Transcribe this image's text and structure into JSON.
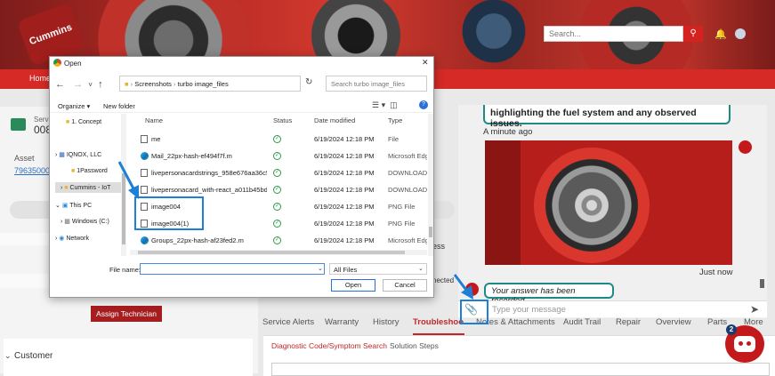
{
  "header": {
    "logo_text": "Cummins",
    "search_placeholder": "Search...",
    "nav_home": "Home"
  },
  "left_panel": {
    "service_label": "Servi",
    "service_value": "008",
    "asset_label": "Asset",
    "asset_value": "79635000",
    "assign_button": "Assign Technician",
    "customer_heading": "Customer"
  },
  "tabs": {
    "items": [
      "Service Alerts",
      "Warranty",
      "History",
      "Troubleshoo",
      "Notes & Attachments",
      "Audit Trail",
      "Repair",
      "Overview",
      "Parts",
      "More"
    ],
    "active": "Troubleshoo",
    "subtabs": [
      "Diagnostic Code/Symptom Search",
      "Solution Steps"
    ]
  },
  "chat": {
    "message1": "highlighting the fuel system and any observed issues.",
    "time1": "A minute ago",
    "time2": "Just now",
    "message2": "Your answer has been recorded.",
    "input_placeholder": "Type your message",
    "bot_badge": "2",
    "partial_less": "ess",
    "partial_connected": "nected"
  },
  "dialog": {
    "title": "Open",
    "address": [
      "Screenshots",
      "turbo image_files"
    ],
    "search_placeholder": "Search turbo image_files",
    "organize": "Organize",
    "new_folder": "New folder",
    "tree": [
      {
        "label": "1. Concept",
        "indent": 1
      },
      {
        "label": "IQNOX, LLC",
        "indent": 0
      },
      {
        "label": "1Password",
        "indent": 1
      },
      {
        "label": "Cummins - IoT",
        "indent": 1,
        "selected": true
      },
      {
        "label": "This PC",
        "indent": 0
      },
      {
        "label": "Windows (C:)",
        "indent": 1
      },
      {
        "label": "Network",
        "indent": 0
      }
    ],
    "columns": [
      "Name",
      "Status",
      "Date modified",
      "Type"
    ],
    "files": [
      {
        "name": "me",
        "date": "6/19/2024 12:18 PM",
        "type": "File",
        "icon": "file"
      },
      {
        "name": "Mail_22px-hash-ef494f7f.m",
        "date": "6/19/2024 12:18 PM",
        "type": "Microsoft Edg",
        "icon": "edge"
      },
      {
        "name": "livepersonacardstrings_958e676aa36c53...",
        "date": "6/19/2024 12:18 PM",
        "type": "DOWNLOAD F",
        "icon": "file"
      },
      {
        "name": "livepersonacard_with-react_a011b45bd9...",
        "date": "6/19/2024 12:18 PM",
        "type": "DOWNLOAD F",
        "icon": "file"
      },
      {
        "name": "image004",
        "date": "6/19/2024 12:18 PM",
        "type": "PNG File",
        "icon": "file"
      },
      {
        "name": "image004(1)",
        "date": "6/19/2024 12:18 PM",
        "type": "PNG File",
        "icon": "file"
      },
      {
        "name": "Groups_22px-hash-af23fed2.m",
        "date": "6/19/2024 12:18 PM",
        "type": "Microsoft Edg",
        "icon": "edge"
      }
    ],
    "file_name_label": "File name:",
    "file_name_value": "",
    "filter": "All Files",
    "open_button": "Open",
    "cancel_button": "Cancel"
  },
  "colors": {
    "brand_red": "#d52a26",
    "highlight_blue": "#1e7fd6",
    "chat_border": "#1e8a86"
  }
}
